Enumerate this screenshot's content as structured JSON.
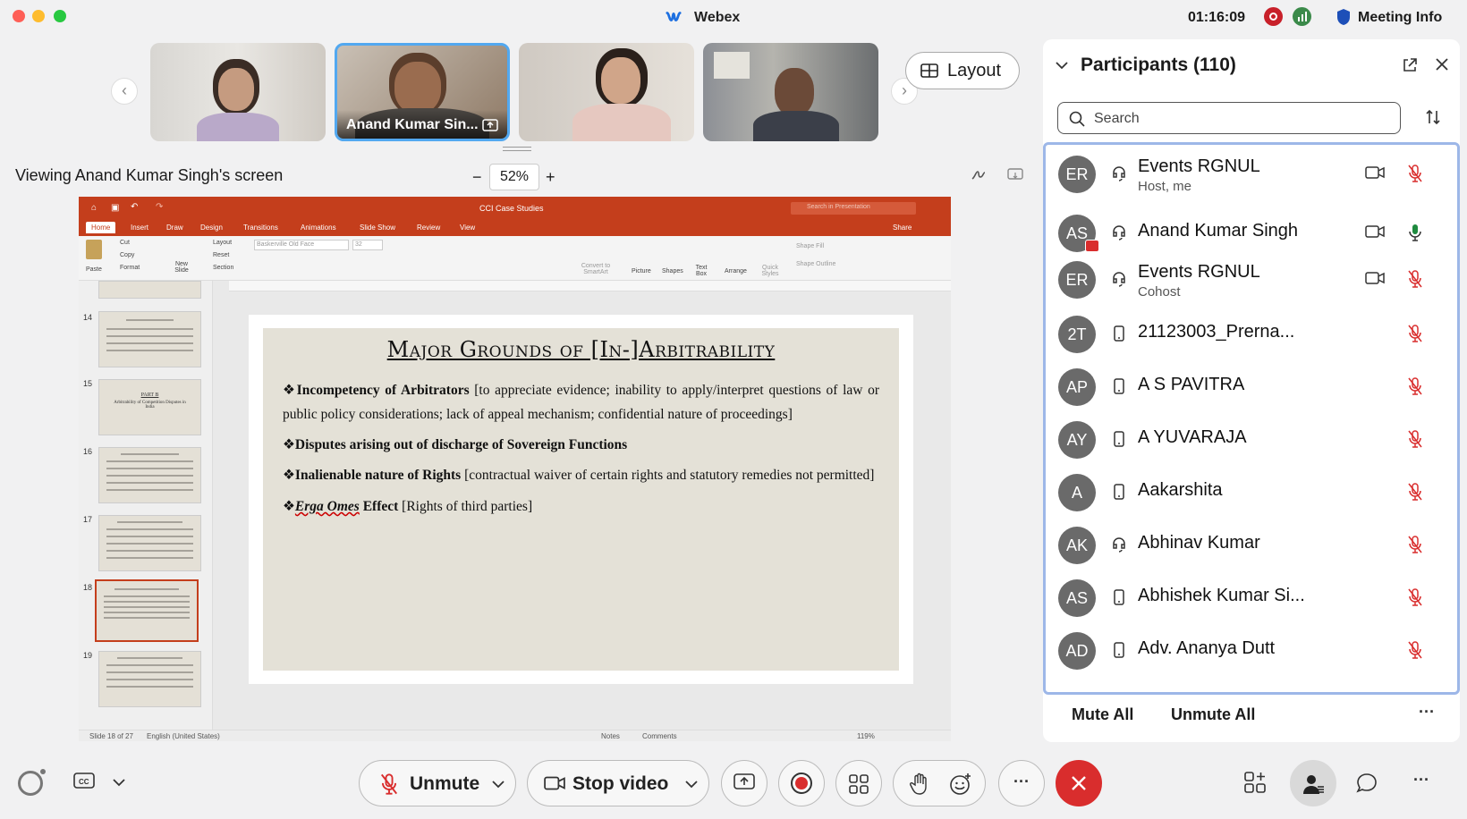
{
  "window": {
    "title": "Webex",
    "clock": "01:16:09",
    "meeting_info": "Meeting Info"
  },
  "stage": {
    "thumbnails": [
      {
        "name": ""
      },
      {
        "name": "Anand Kumar Sin..."
      },
      {
        "name": ""
      },
      {
        "name": ""
      }
    ],
    "layout_label": "Layout",
    "viewing_text": "Viewing Anand Kumar Singh's screen",
    "zoom_minus": "−",
    "zoom_value": "52%",
    "zoom_plus": "+"
  },
  "shared_screen": {
    "doc_title": "CCI Case Studies",
    "search_placeholder": "Search in Presentation",
    "share_label": "Share",
    "tabs": [
      "Home",
      "Insert",
      "Draw",
      "Design",
      "Transitions",
      "Animations",
      "Slide Show",
      "Review",
      "View"
    ],
    "ribbon": {
      "paste": "Paste",
      "cut": "Cut",
      "copy": "Copy",
      "format": "Format",
      "new_slide": "New Slide",
      "layout": "Layout",
      "reset": "Reset",
      "section": "Section",
      "font": "Baskerville Old Face",
      "size": "32",
      "convert": "Convert to SmartArt",
      "picture": "Picture",
      "shapes": "Shapes",
      "textbox": "Text Box",
      "arrange": "Arrange",
      "quick_styles": "Quick Styles",
      "shape_fill": "Shape Fill",
      "shape_outline": "Shape Outline"
    },
    "slide_numbers": [
      "14",
      "15",
      "16",
      "17",
      "18",
      "19"
    ],
    "thumb15_title": "PART B",
    "thumb15_sub": "Arbitrability of Competition Disputes in India",
    "status_left": "Slide 18 of 27",
    "status_lang": "English (United States)",
    "status_notes": "Notes",
    "status_comments": "Comments",
    "status_zoom": "119%",
    "slide": {
      "title": "Major Grounds of [In-]Arbitrability",
      "b1_bold": "Incompetency of Arbitrators",
      "b1_rest": " [to appreciate evidence; inability to apply/interpret questions of law or public policy considerations; lack of appeal mechanism; confidential nature of proceedings]",
      "b2_bold": "Disputes arising out of discharge of Sovereign Functions",
      "b3_bold": "Inalienable nature of Rights",
      "b3_rest": " [contractual waiver of certain rights and statutory remedies not permitted]",
      "b4_italic": "Erga Omes",
      "b4_bold": " Effect",
      "b4_rest": " [Rights of third parties]"
    }
  },
  "participants": {
    "title": "Participants (110)",
    "search_placeholder": "Search",
    "list": [
      {
        "initials": "ER",
        "name": "Events RGNUL",
        "sub": "Host, me",
        "device": "headset",
        "video": true,
        "mic": "muted"
      },
      {
        "initials": "AS",
        "name": "Anand Kumar Singh",
        "sub": "",
        "device": "headset",
        "video": true,
        "mic": "active"
      },
      {
        "initials": "ER",
        "name": "Events RGNUL",
        "sub": "Cohost",
        "device": "headset",
        "video": true,
        "mic": "muted"
      },
      {
        "initials": "2T",
        "name": "21123003_Prerna...",
        "sub": "",
        "device": "phone",
        "video": false,
        "mic": "muted"
      },
      {
        "initials": "AP",
        "name": "A S PAVITRA",
        "sub": "",
        "device": "phone",
        "video": false,
        "mic": "muted"
      },
      {
        "initials": "AY",
        "name": "A YUVARAJA",
        "sub": "",
        "device": "phone",
        "video": false,
        "mic": "muted"
      },
      {
        "initials": "A",
        "name": "Aakarshita",
        "sub": "",
        "device": "phone",
        "video": false,
        "mic": "muted"
      },
      {
        "initials": "AK",
        "name": "Abhinav Kumar",
        "sub": "",
        "device": "headset",
        "video": false,
        "mic": "muted"
      },
      {
        "initials": "AS",
        "name": "Abhishek Kumar Si...",
        "sub": "",
        "device": "phone",
        "video": false,
        "mic": "muted"
      },
      {
        "initials": "AD",
        "name": "Adv. Ananya Dutt",
        "sub": "",
        "device": "phone",
        "video": false,
        "mic": "muted"
      }
    ],
    "mute_all": "Mute All",
    "unmute_all": "Unmute All"
  },
  "controls": {
    "unmute": "Unmute",
    "stop_video": "Stop video"
  },
  "colors": {
    "accent_red": "#d92d2d",
    "ppt_orange": "#c43e1c",
    "selection_blue": "#9db7e8"
  }
}
